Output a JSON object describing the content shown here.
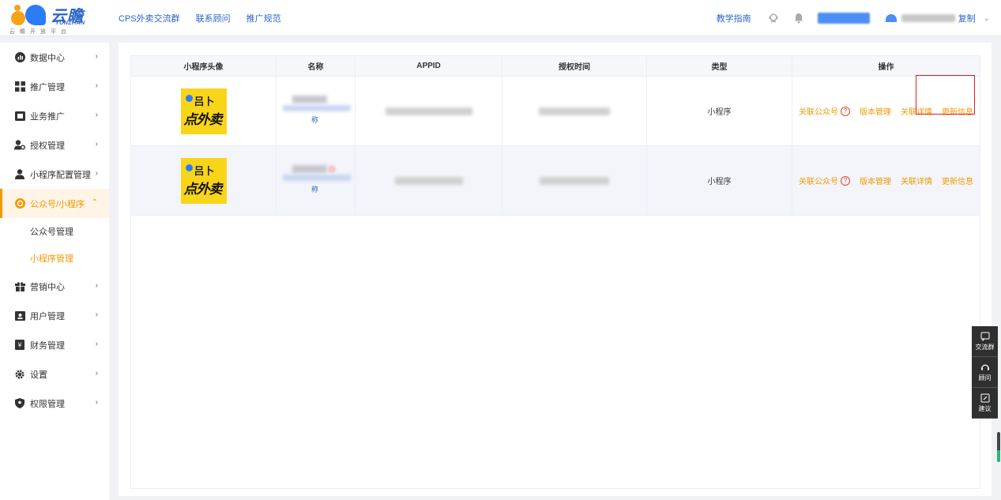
{
  "header": {
    "logo_text": "云瞻",
    "logo_en": "YUNZHAN",
    "logo_sub": "云瞻开放平台",
    "nav": [
      "CPS外卖交流群",
      "联系顾问",
      "推广规范"
    ],
    "guide": "教学指南",
    "copy": "复制"
  },
  "sidebar": {
    "items": [
      {
        "label": "数据中心",
        "icon": "chart-circle-icon"
      },
      {
        "label": "推广管理",
        "icon": "grid-icon"
      },
      {
        "label": "业务推广",
        "icon": "monitor-icon"
      },
      {
        "label": "授权管理",
        "icon": "user-key-icon"
      },
      {
        "label": "小程序配置管理",
        "icon": "user-icon"
      },
      {
        "label": "公众号/小程序",
        "icon": "miniapp-icon"
      }
    ],
    "sub_items": [
      "公众号管理",
      "小程序管理"
    ],
    "items_after": [
      {
        "label": "营销中心",
        "icon": "gift-icon"
      },
      {
        "label": "用户管理",
        "icon": "id-card-icon"
      },
      {
        "label": "财务管理",
        "icon": "wallet-icon"
      },
      {
        "label": "设置",
        "icon": "gear-icon"
      },
      {
        "label": "权限管理",
        "icon": "shield-icon"
      }
    ]
  },
  "table": {
    "headers": [
      "小程序头像",
      "名称",
      "APPID",
      "授权时间",
      "类型",
      "操作"
    ],
    "rows": [
      {
        "name_tail": "称",
        "type": "小程序",
        "avatar_text": "点外卖",
        "avatar_top": "吕卜"
      },
      {
        "name_tail": "称",
        "type": "小程序",
        "avatar_text": "点外卖",
        "avatar_top": "吕卜"
      }
    ],
    "ops": [
      "关联公众号",
      "版本管理",
      "关联详情",
      "更新信息"
    ],
    "help": "?"
  },
  "float": [
    "交流群",
    "顾问",
    "建议"
  ],
  "colors": {
    "accent": "#f39800",
    "link": "#2b65c8",
    "highlight": "#e02020"
  }
}
